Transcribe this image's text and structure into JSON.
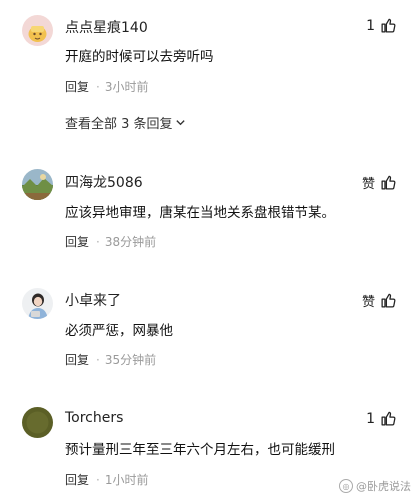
{
  "comments": [
    {
      "username": "点点星痕140",
      "text": "开庭的时候可以去旁听吗",
      "reply_label": "回复",
      "time": "3小时前",
      "likes": "1",
      "avatar": "cartoon-avatar-icon"
    },
    {
      "username": "四海龙5086",
      "text": "应该异地审理，唐某在当地关系盘根错节某。",
      "reply_label": "回复",
      "time": "38分钟前",
      "like_label": "赞",
      "avatar": "landscape-avatar-icon"
    },
    {
      "username": "小卓来了",
      "text": "必须严惩，网暴他",
      "reply_label": "回复",
      "time": "35分钟前",
      "like_label": "赞",
      "avatar": "person-avatar-icon"
    },
    {
      "username": "Torchers",
      "text": "预计量刑三年至三年六个月左右，也可能缓刑",
      "reply_label": "回复",
      "time": "1小时前",
      "likes": "1",
      "avatar": "plain-avatar-icon"
    }
  ],
  "view_all_replies": "查看全部 3 条回复",
  "watermark": "@卧虎说法"
}
